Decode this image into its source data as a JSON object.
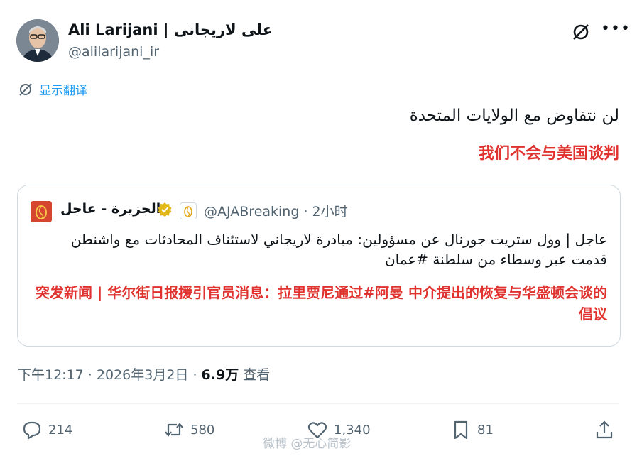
{
  "author": {
    "name": "Ali Larijani | علی لاریجانی",
    "handle": "@alilarijani_ir"
  },
  "translate_label": "显示翻译",
  "tweet": {
    "text_ar": "لن نتفاوض مع الولايات المتحدة",
    "text_cn": "我们不会与美国谈判"
  },
  "quote": {
    "name": "الجزيرة - عاجل",
    "handle_time": "@AJABreaking · 2小时",
    "text_ar": "عاجل | وول ستريت جورنال عن مسؤولين: مبادرة لاريجاني لاستئناف المحادثات مع واشنطن قدمت عبر وسطاء من سلطنة #عمان",
    "text_cn": "突发新闻 | 华尔街日报援引官员消息：拉里贾尼通过#阿曼 中介提出的恢复与华盛顿会谈的倡议"
  },
  "meta": {
    "time_date": "下午12:17 · 2026年3月2日 · ",
    "views_count": "6.9万",
    "views_label": " 查看"
  },
  "actions": {
    "replies": "214",
    "retweets": "580",
    "likes": "1,340",
    "bookmarks": "81"
  },
  "watermark": "微博 @无心简影",
  "colors": {
    "link_blue": "#1d9bf0",
    "translation_red": "#e0322f",
    "secondary_gray": "#536471"
  }
}
